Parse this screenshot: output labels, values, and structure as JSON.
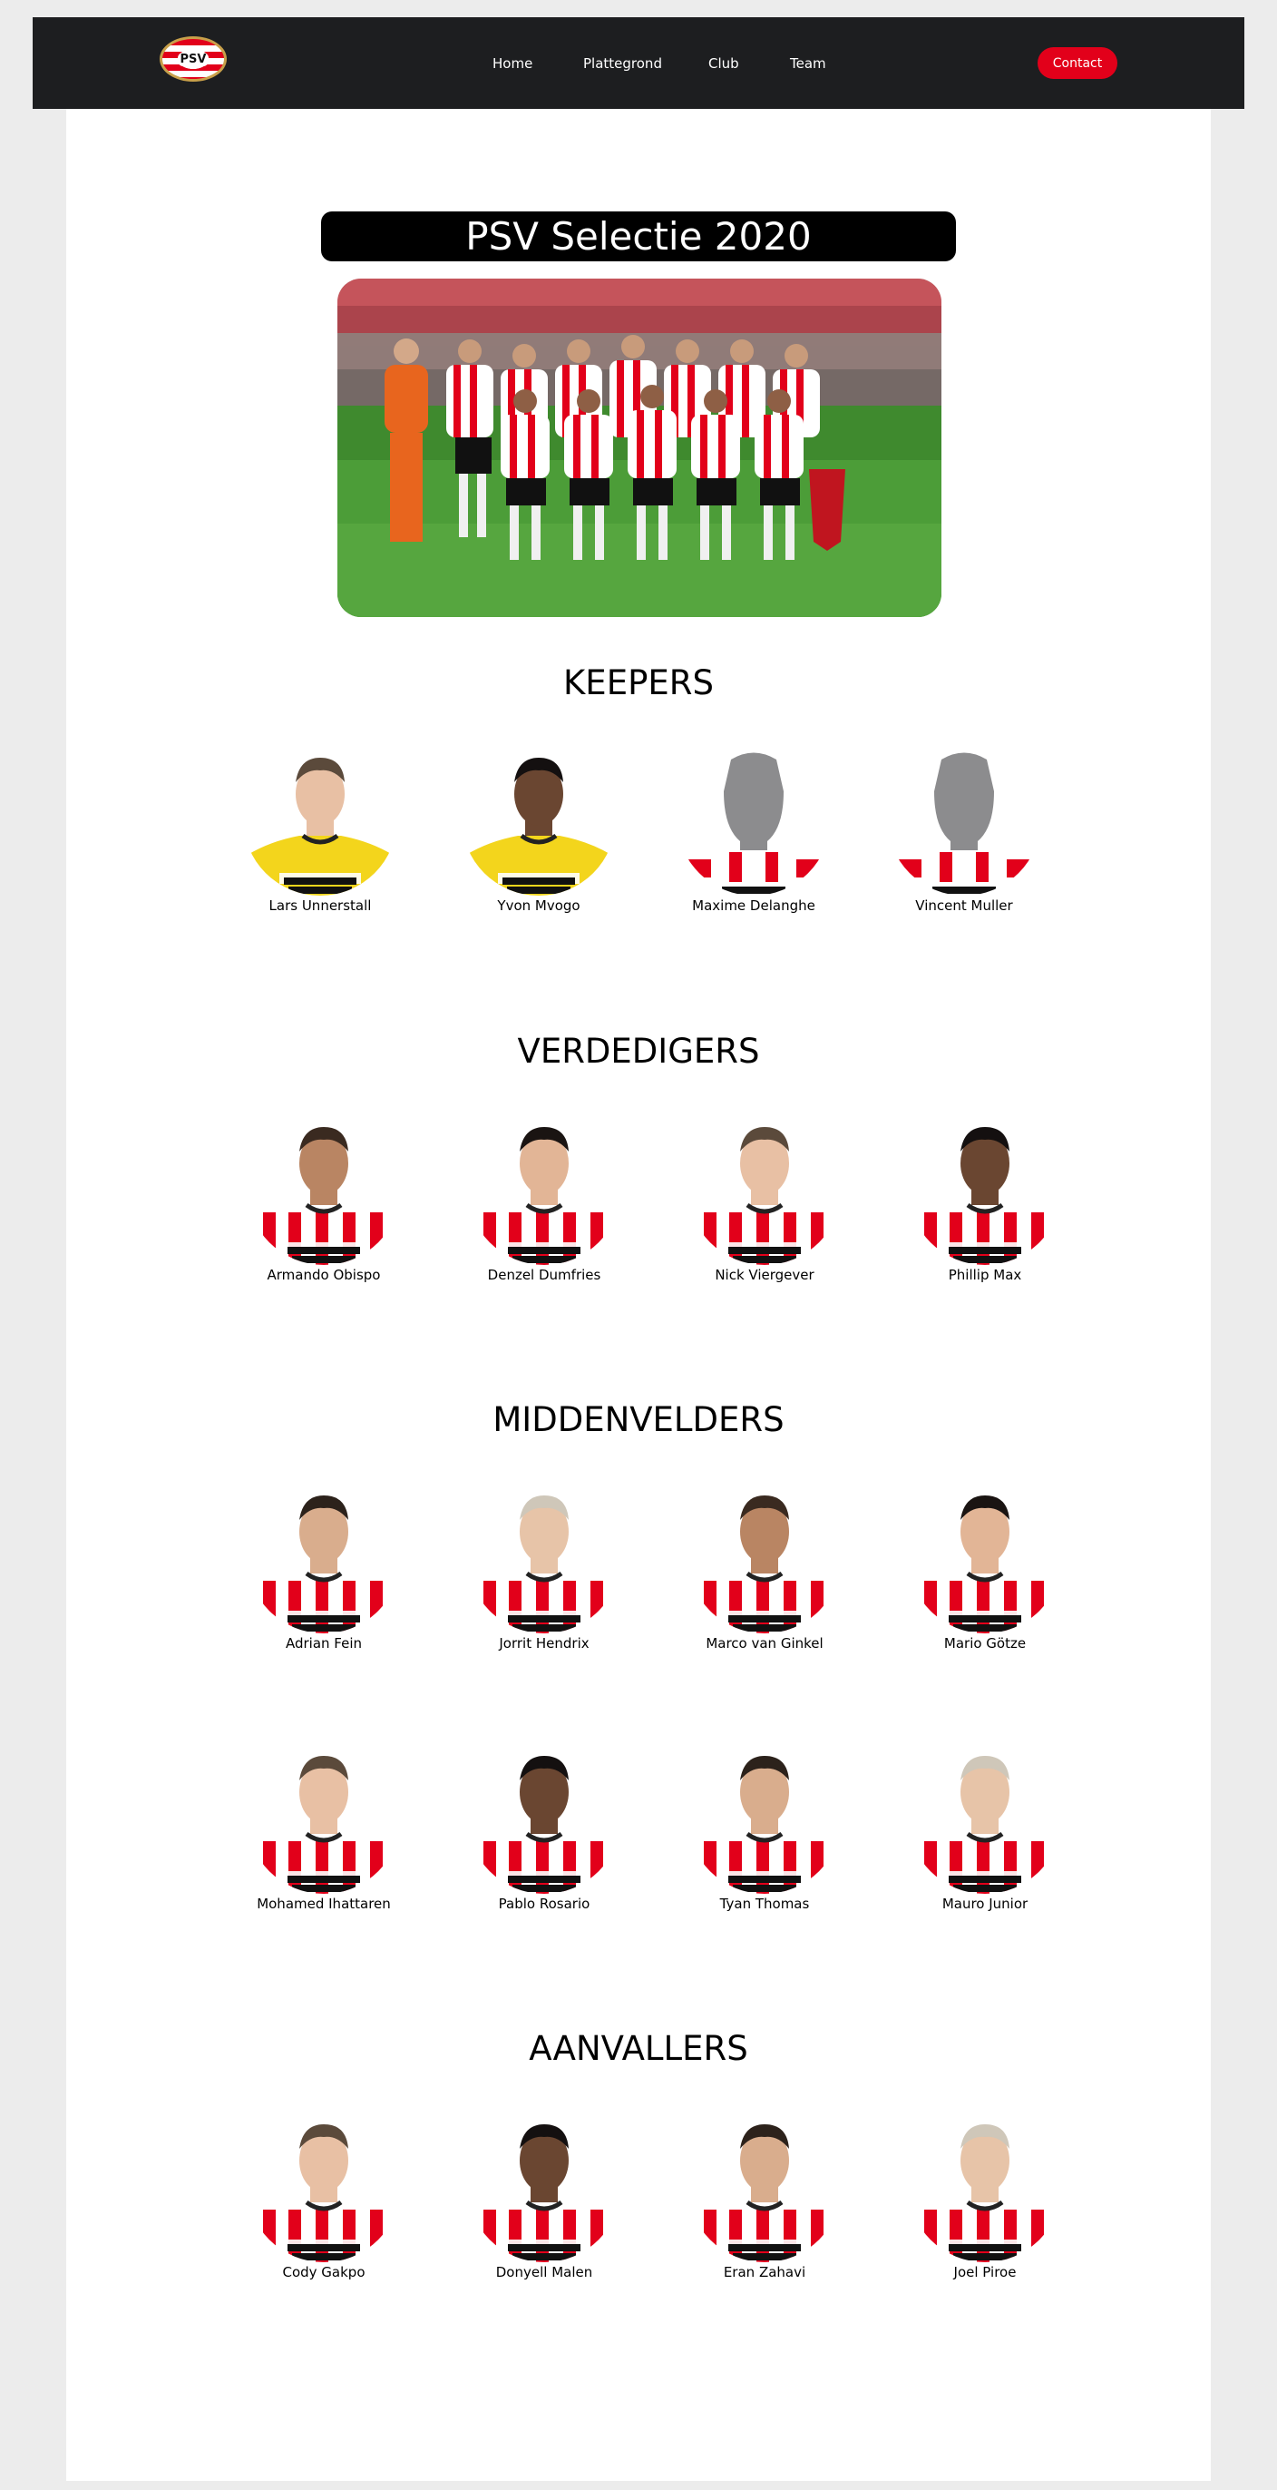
{
  "nav": {
    "logo_text": "PSV",
    "links": [
      "Home",
      "Plattegrond",
      "Club",
      "Team"
    ],
    "contact_label": "Contact"
  },
  "page": {
    "title": "PSV Selectie 2020"
  },
  "sections": [
    {
      "title": "KEEPERS",
      "players": [
        {
          "name": "Lars Unnerstall",
          "kit": "keeper"
        },
        {
          "name": "Yvon Mvogo",
          "kit": "keeper-dark"
        },
        {
          "name": "Maxime Delanghe",
          "kit": "silhouette"
        },
        {
          "name": "Vincent Muller",
          "kit": "silhouette"
        }
      ]
    },
    {
      "title": "VERDEDIGERS",
      "players": [
        {
          "name": "Armando Obispo",
          "kit": "home"
        },
        {
          "name": "Denzel Dumfries",
          "kit": "home"
        },
        {
          "name": "Nick Viergever",
          "kit": "home"
        },
        {
          "name": "Phillip Max",
          "kit": "home"
        }
      ]
    },
    {
      "title": "MIDDENVELDERS",
      "players": [
        {
          "name": "Adrian Fein",
          "kit": "home"
        },
        {
          "name": "Jorrit Hendrix",
          "kit": "home"
        },
        {
          "name": "Marco van Ginkel",
          "kit": "home"
        },
        {
          "name": "Mario Götze",
          "kit": "home"
        },
        {
          "name": "Mohamed Ihattaren",
          "kit": "home"
        },
        {
          "name": "Pablo Rosario",
          "kit": "home"
        },
        {
          "name": "Tyan Thomas",
          "kit": "home"
        },
        {
          "name": "Mauro Junior",
          "kit": "home"
        }
      ]
    },
    {
      "title": "AANVALLERS",
      "players": [
        {
          "name": "Cody Gakpo",
          "kit": "home"
        },
        {
          "name": "Donyell Malen",
          "kit": "home"
        },
        {
          "name": "Eran Zahavi",
          "kit": "home"
        },
        {
          "name": "Joel Piroe",
          "kit": "home"
        }
      ]
    }
  ],
  "colors": {
    "brand_red": "#e2001a",
    "navbar": "#1d1e20",
    "keeper_yellow": "#f3d51c",
    "silhouette_grey": "#8c8c8e"
  }
}
